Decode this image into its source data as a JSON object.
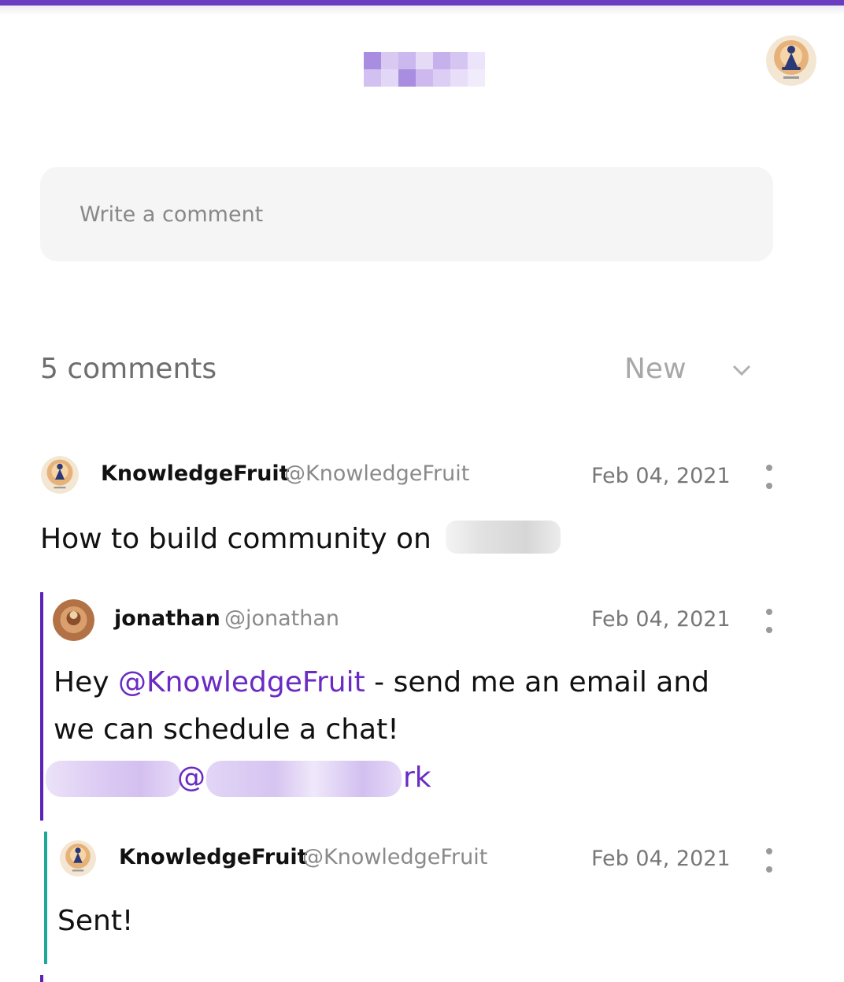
{
  "header": {
    "accent_color": "#6a3cc0",
    "logo_redacted": true
  },
  "composer": {
    "placeholder": "Write a comment"
  },
  "comments_header": {
    "count_label": "5 comments",
    "sort_selected": "New",
    "sort_icon": "chevron-down-icon"
  },
  "comments": [
    {
      "author": "KnowledgeFruit",
      "handle": "@KnowledgeFruit",
      "date": "Feb 04, 2021",
      "text": "How to build community on",
      "text_redacted_suffix": true,
      "thread_color": ""
    },
    {
      "author": "jonathan",
      "handle": "@jonathan",
      "date": "Feb 04, 2021",
      "text_line1_prefix": "Hey ",
      "mention": "@KnowledgeFruit",
      "text_line1_suffix": " - send me an email and",
      "text_line2": "we can schedule a chat!",
      "email_visible_at": "@",
      "email_visible_tail": "rk",
      "thread_color": "#5b22b8"
    },
    {
      "author": "KnowledgeFruit",
      "handle": "@KnowledgeFruit",
      "date": "Feb 04, 2021",
      "text": "Sent!",
      "thread_color": "#1fa89a"
    }
  ]
}
